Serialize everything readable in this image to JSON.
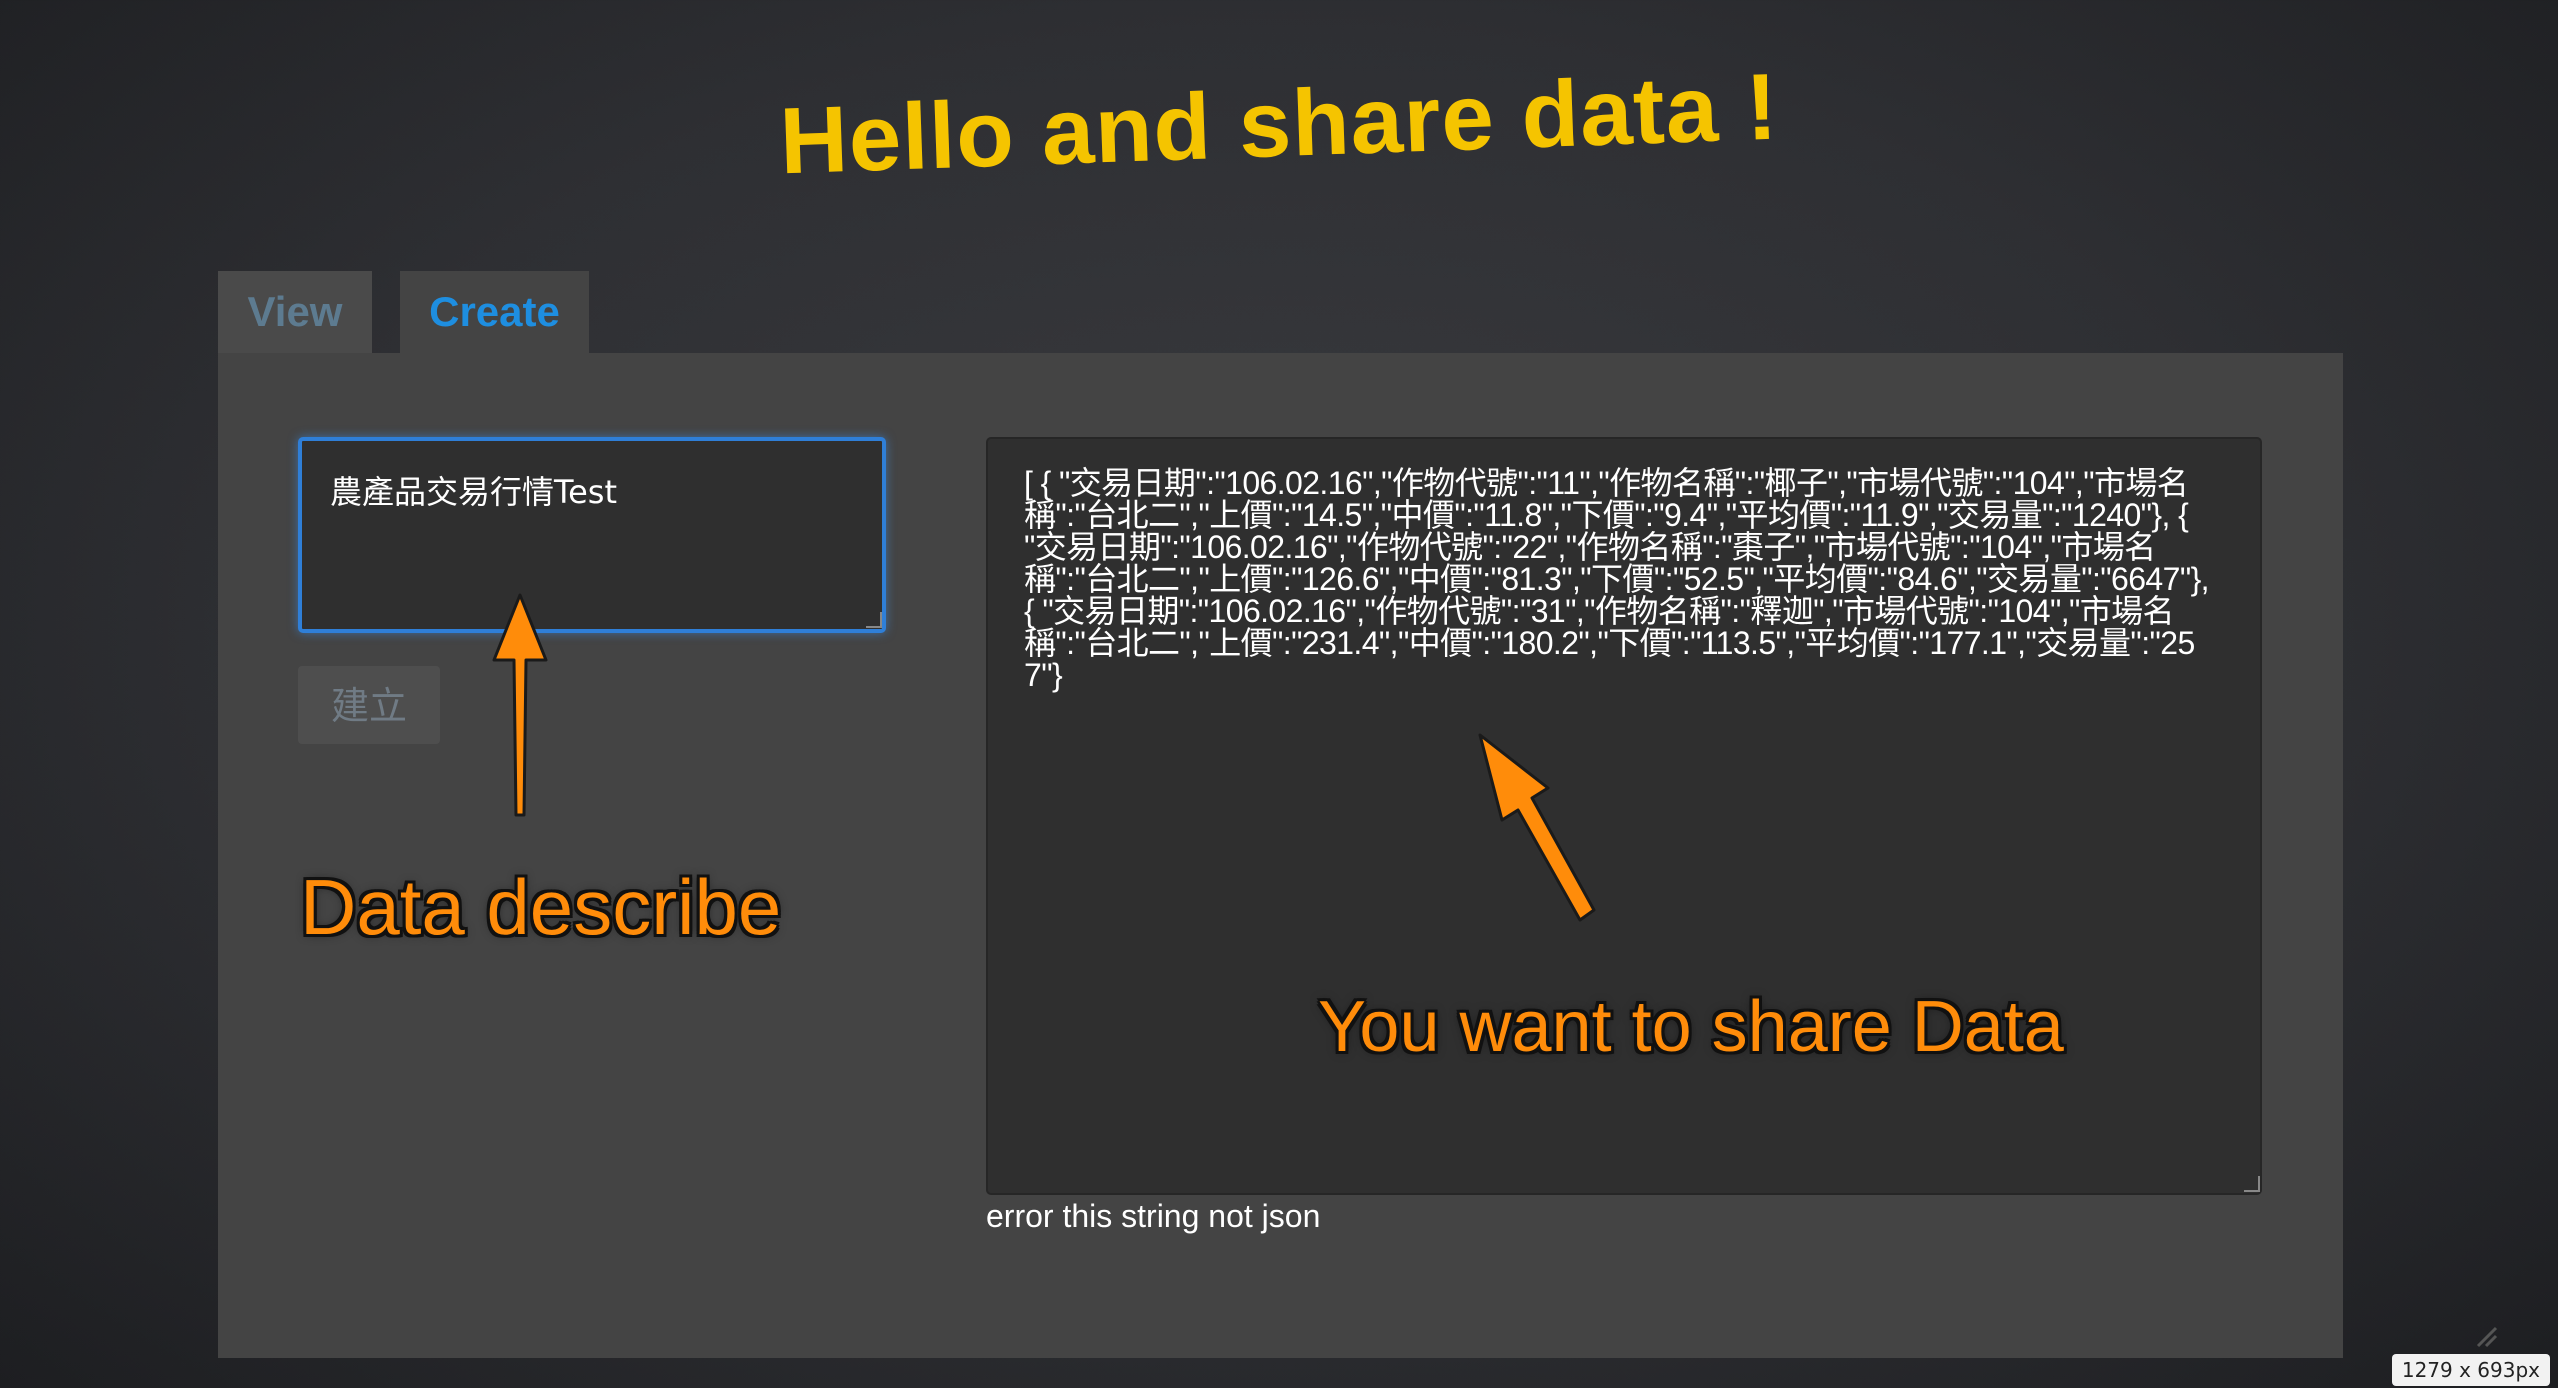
{
  "app": {
    "title": "Hello and share data !"
  },
  "tabs": [
    {
      "label": "View",
      "active": false
    },
    {
      "label": "Create",
      "active": true
    }
  ],
  "create_form": {
    "describe_value": "農產品交易行情Test",
    "submit_label": "建立",
    "data_value": "[ { \"交易日期\":\"106.02.16\",\"作物代號\":\"11\",\"作物名稱\":\"椰子\",\"市場代號\":\"104\",\"市場名稱\":\"台北二\",\"上價\":\"14.5\",\"中價\":\"11.8\",\"下價\":\"9.4\",\"平均價\":\"11.9\",\"交易量\":\"1240\"}, { \"交易日期\":\"106.02.16\",\"作物代號\":\"22\",\"作物名稱\":\"棗子\",\"市場代號\":\"104\",\"市場名稱\":\"台北二\",\"上價\":\"126.6\",\"中價\":\"81.3\",\"下價\":\"52.5\",\"平均價\":\"84.6\",\"交易量\":\"6647\"}, { \"交易日期\":\"106.02.16\",\"作物代號\":\"31\",\"作物名稱\":\"釋迦\",\"市場代號\":\"104\",\"市場名稱\":\"台北二\",\"上價\":\"231.4\",\"中價\":\"180.2\",\"下價\":\"113.5\",\"平均價\":\"177.1\",\"交易量\":\"257\"}",
    "error_text": "error this string not json"
  },
  "annotations": {
    "describe_label": "Data describe",
    "share_label": "You want to share Data"
  },
  "screenshot_size_label": "1279 x 693px",
  "colors": {
    "title": "#f5c400",
    "active_tab": "#1e8ee0",
    "inactive_tab": "#5d7b90",
    "annotation": "#ff8c0a",
    "focus_border": "#2f7fd8"
  },
  "icons": {
    "arrow_describe": "up-arrow-icon",
    "arrow_share": "up-left-arrow-icon",
    "corner": "resize-corner-icon"
  }
}
